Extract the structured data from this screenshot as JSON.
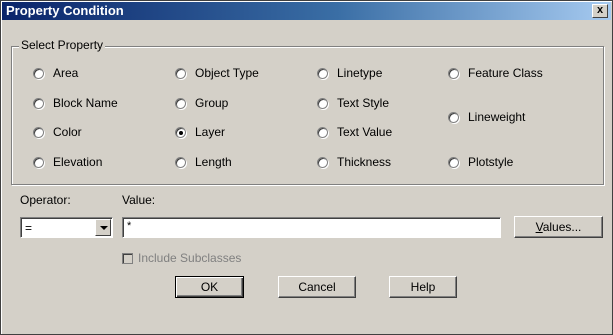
{
  "window": {
    "title": "Property Condition",
    "close_label": "x"
  },
  "group": {
    "legend": "Select Property",
    "options": [
      {
        "label": "Area",
        "checked": false
      },
      {
        "label": "Block Name",
        "checked": false
      },
      {
        "label": "Color",
        "checked": false
      },
      {
        "label": "Elevation",
        "checked": false
      },
      {
        "label": "Object Type",
        "checked": false
      },
      {
        "label": "Group",
        "checked": false
      },
      {
        "label": "Layer",
        "checked": true
      },
      {
        "label": "Length",
        "checked": false
      },
      {
        "label": "Linetype",
        "checked": false
      },
      {
        "label": "Text Style",
        "checked": false
      },
      {
        "label": "Text Value",
        "checked": false
      },
      {
        "label": "Thickness",
        "checked": false
      },
      {
        "label": "Feature Class",
        "checked": false
      },
      {
        "label": "Lineweight",
        "checked": false
      },
      {
        "label": "Plotstyle",
        "checked": false
      }
    ]
  },
  "operator": {
    "label": "Operator:",
    "value": "="
  },
  "value_field": {
    "label": "Value:",
    "value": "*"
  },
  "values_button": {
    "accel": "V",
    "rest": "alues..."
  },
  "include_subclasses": {
    "accel": "I",
    "rest": "nclude Subclasses",
    "checked": false,
    "enabled": false
  },
  "buttons": {
    "ok": "OK",
    "cancel": "Cancel",
    "help": "Help"
  }
}
